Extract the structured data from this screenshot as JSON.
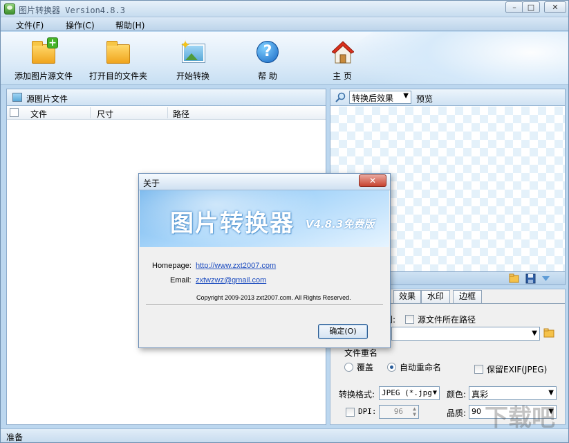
{
  "window": {
    "title": "图片转换器 Version4.8.3",
    "controls": {
      "minimize": "–",
      "maximize": "□",
      "close": "✕"
    }
  },
  "menu": {
    "file": "文件(F)",
    "operate": "操作(C)",
    "help": "帮助(H)"
  },
  "toolbar": {
    "add": "添加图片源文件",
    "open": "打开目的文件夹",
    "start": "开始转换",
    "help": "帮 助",
    "home": "主 页"
  },
  "left_panel": {
    "title": "源图片文件",
    "columns": [
      "文件",
      "尺寸",
      "路径"
    ]
  },
  "preview": {
    "select_value": "转换后效果",
    "label": "预览"
  },
  "settings": {
    "tabs": [
      "效果",
      "水印",
      "边框"
    ],
    "output_partial": "到:",
    "source_path_label": "源文件所在路径",
    "rename_group": "文件重名",
    "overwrite": "覆盖",
    "auto_rename": "自动重命名",
    "keep_exif": "保留EXIF(JPEG)",
    "format_label": "转换格式:",
    "format_value": "JPEG (*.jpg",
    "color_label": "颜色:",
    "color_value": "真彩",
    "dpi_label": "DPI:",
    "dpi_value": "96",
    "quality_label": "品质:",
    "quality_value": "90"
  },
  "status": {
    "text": "准备"
  },
  "dialog": {
    "title": "关于",
    "close": "✕",
    "app_name": "图片转换器",
    "version": "V4.8.3免费版",
    "homepage_label": "Homepage:",
    "homepage_url": "http://www.zxt2007.com",
    "email_label": "Email:",
    "email": "zxtwzwz@gmail.com",
    "copyright": "Copyright 2009-2013 zxt2007.com. All Rights Reserved.",
    "ok": "确定(O)"
  },
  "watermark": {
    "text": "下载吧"
  },
  "colors": {
    "accent": "#3c7fc4",
    "titlebar": "#c6dcef",
    "dialog_close": "#c7432f"
  }
}
